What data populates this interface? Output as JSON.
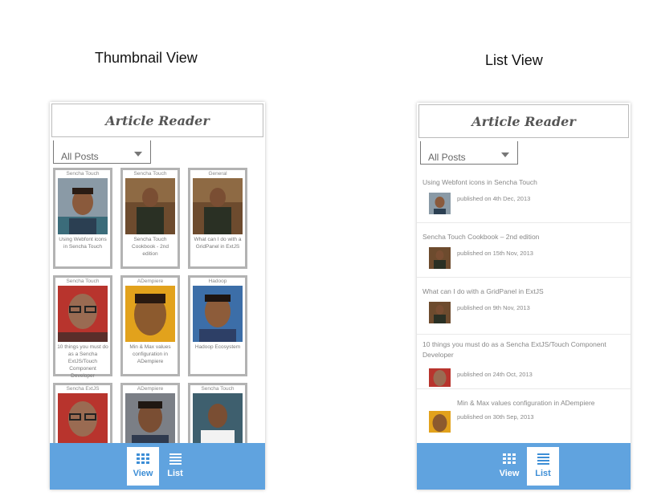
{
  "captions": {
    "thumbnail": "Thumbnail View",
    "list": "List View"
  },
  "app": {
    "title": "Article Reader",
    "filter": "All Posts"
  },
  "tabs": {
    "view": "View",
    "list": "List"
  },
  "thumbnail_tiles": [
    {
      "category": "Sencha Touch",
      "title": "Using Webfont icons in Sencha Touch"
    },
    {
      "category": "Sencha Touch",
      "title": "Sencha Touch Cookbook - 2nd edition"
    },
    {
      "category": "General",
      "title": "What can I do with a GridPanel in ExtJS"
    },
    {
      "category": "Sencha Touch",
      "title": "10 things you must do as a Sencha ExtJS/Touch Component Developer"
    },
    {
      "category": "ADempiere",
      "title": "Min & Max values configuration in ADempiere"
    },
    {
      "category": "Hadoop",
      "title": "Hadoop Ecosystem"
    },
    {
      "category": "Sencha ExtJS",
      "title": ""
    },
    {
      "category": "ADempiere",
      "title": ""
    },
    {
      "category": "Sencha Touch",
      "title": ""
    }
  ],
  "list_items": [
    {
      "title": "Using Webfont icons in Sencha Touch",
      "published": "published on 4th Dec, 2013"
    },
    {
      "title": "Sencha Touch Cookbook – 2nd edition",
      "published": "published on 15th Nov, 2013"
    },
    {
      "title": "What can I do with a GridPanel in ExtJS",
      "published": "published on 9th Nov, 2013"
    },
    {
      "title": "10 things you must do as a Sencha ExtJS/Touch Component Developer",
      "published": "published on 24th Oct, 2013"
    },
    {
      "title": "Min & Max values configuration in ADempiere",
      "published": "published on 30th Sep, 2013"
    }
  ],
  "colors": {
    "tabbar": "#60a3df",
    "tile_border": "#b3b3b3"
  }
}
